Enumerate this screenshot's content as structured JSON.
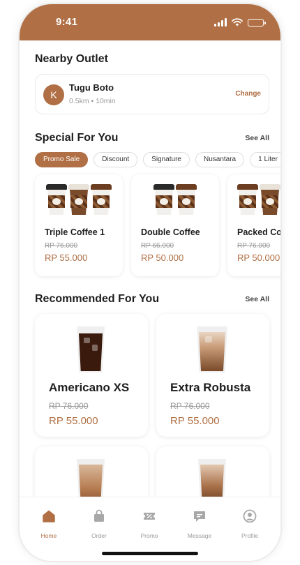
{
  "status_bar": {
    "time": "9:41"
  },
  "outlet": {
    "section_title": "Nearby Outlet",
    "initial": "K",
    "name": "Tugu Boto",
    "distance": "0.5km",
    "separator": "•",
    "duration": "10min",
    "change_label": "Change"
  },
  "special": {
    "title": "Special For You",
    "see_all": "See All",
    "filters": [
      "Promo Sale",
      "Discount",
      "Signature",
      "Nusantara",
      "1 Liter"
    ],
    "active_filter": "Promo Sale",
    "items": [
      {
        "name": "Triple Coffee 1",
        "old_price": "RP 76.000",
        "new_price": "RP 55.000"
      },
      {
        "name": "Double Coffee",
        "old_price": "RP 66.000",
        "new_price": "RP 50.000"
      },
      {
        "name": "Packed Co",
        "old_price": "RP 76.000",
        "new_price": "RP 50.000"
      }
    ]
  },
  "recommended": {
    "title": "Recommended For You",
    "see_all": "See All",
    "items": [
      {
        "name": "Americano XS",
        "old_price": "RP 76.000",
        "new_price": "RP 55.000"
      },
      {
        "name": "Extra Robusta",
        "old_price": "RP 76.000",
        "new_price": "RP 55.000"
      },
      {
        "name": "",
        "old_price": "",
        "new_price": ""
      },
      {
        "name": "",
        "old_price": "",
        "new_price": ""
      }
    ]
  },
  "nav": {
    "items": [
      {
        "label": "Home",
        "icon": "home-icon",
        "active": true
      },
      {
        "label": "Order",
        "icon": "shopping-bag-icon",
        "active": false
      },
      {
        "label": "Promo",
        "icon": "discount-ticket-icon",
        "active": false
      },
      {
        "label": "Message",
        "icon": "chat-bubble-icon",
        "active": false
      },
      {
        "label": "Profile",
        "icon": "user-circle-icon",
        "active": false
      }
    ]
  },
  "colors": {
    "accent": "#b06f44",
    "text": "#1e1e1e",
    "muted": "#9a9a9a"
  }
}
